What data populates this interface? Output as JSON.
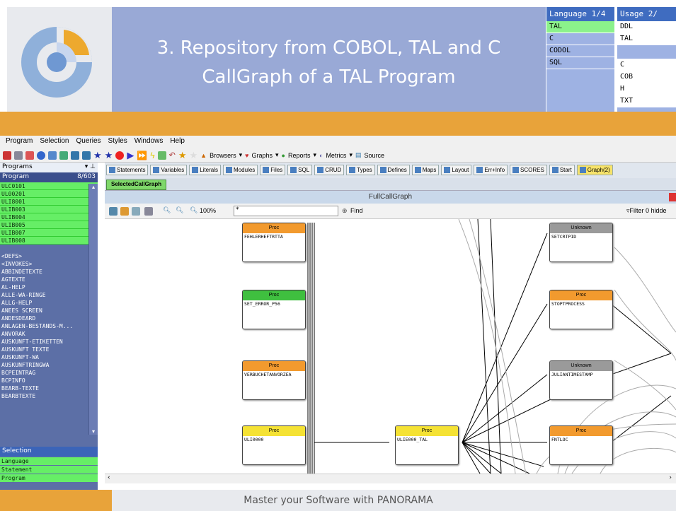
{
  "slide": {
    "title_line1": "3. Repository from COBOL, TAL and C",
    "title_line2": "CallGraph of a TAL Program",
    "footer": "Master your Software with PANORAMA"
  },
  "language_box": {
    "header": "Language  1/4",
    "rows": [
      "TAL",
      "C",
      "CODOL",
      "SQL"
    ],
    "selected": "TAL"
  },
  "usage_box": {
    "header": "Usage     2/",
    "rows": [
      "DDL",
      "TAL",
      "",
      "C",
      "COB",
      "H",
      "TXT"
    ]
  },
  "menubar": {
    "items": [
      "Program",
      "Selection",
      "Queries",
      "Styles",
      "Windows",
      "Help"
    ]
  },
  "toolbar": {
    "browsers": "Browsers",
    "graphs": "Graphs",
    "reports": "Reports",
    "metrics": "Metrics",
    "source": "Source"
  },
  "left_panel": {
    "title": "Programs",
    "list_header": "Program",
    "count": "8/603",
    "green_items": [
      "ULC0101",
      "UL00201",
      "ULI8001",
      "ULIB003",
      "ULIB004",
      "ULIB005",
      "ULIB007",
      "ULIB008"
    ],
    "items": [
      "",
      "<DEFS>",
      "<INVOKES>",
      "ABBINDETEXTE",
      "AGTEXTE",
      "AL-HELP",
      "ALLE-WA-RINGE",
      "ALLG-HELP",
      "ANEES SCREEN",
      "ANDESDEARD",
      "ANLAGEN-BESTANDS-M...",
      "ANVORAK",
      "AUSKUNFT-ETIKETTEN",
      "AUSKUNFT TEXTE",
      "AUSKUNFT-WA",
      "AUSKUNFTRINGWA",
      "BCPEINTRAG",
      "BCPINFO",
      "BEARB-TEXTE",
      "BEARBTEXTE"
    ]
  },
  "selection_panel": {
    "title": "Selection",
    "items": [
      "Language",
      "Statement",
      "Program"
    ]
  },
  "tabs": [
    "Statements",
    "Variables",
    "Literals",
    "Modules",
    "Files",
    "SQL",
    "CRUD",
    "Types",
    "Defines",
    "Maps",
    "Layout",
    "Err+Info",
    "SCORES",
    "Start",
    "Graph(2)"
  ],
  "subtab": "SelectedCallGraph",
  "graph": {
    "title": "FullCallGraph",
    "zoom": "100%",
    "find_value": "*",
    "find_label": "Find",
    "filter_label": "Filter 0 hidde",
    "nodes": [
      {
        "kind": "Proc",
        "name": "FEHLERHEFTRTTA",
        "color": "#f29a2e"
      },
      {
        "kind": "Proc",
        "name": "SET_ERROR_P56",
        "color": "#3fbf3f"
      },
      {
        "kind": "Proc",
        "name": "VERBUCHETANVORZEA",
        "color": "#f29a2e"
      },
      {
        "kind": "Proc",
        "name": "ULI0000",
        "color": "#f5e234"
      },
      {
        "kind": "Proc",
        "name": "ULIE000_TAL",
        "color": "#f5e234"
      },
      {
        "kind": "Unknown",
        "name": "SETCRTPID",
        "color": "#9a9a9a"
      },
      {
        "kind": "Proc",
        "name": "STOPTPROCESS",
        "color": "#f29a2e"
      },
      {
        "kind": "Unknown",
        "name": "JULIANTIMESTAMP",
        "color": "#9a9a9a"
      },
      {
        "kind": "Proc",
        "name": "FNTLOC",
        "color": "#f29a2e"
      }
    ]
  },
  "colors": {
    "title_bg": "#99a9d6",
    "accent_orange": "#e8a33a",
    "list_green": "#66ee66",
    "panel_blue": "#5c6fa6"
  }
}
